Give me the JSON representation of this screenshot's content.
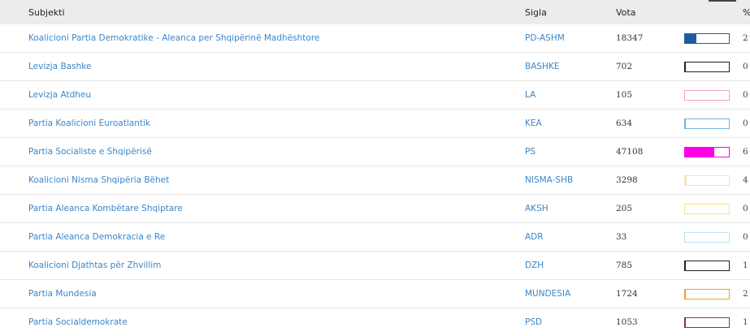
{
  "columns": {
    "subjekti": "Subjekti",
    "sigla": "Sigla",
    "vota": "Vota",
    "percent": "%"
  },
  "rows": [
    {
      "subjekti": "Koalicioni Partia Demokratike - Aleanca per Shqipërinë Madhështore",
      "sigla": "PD-ASHM",
      "vota": "18347",
      "percent_cut": "2",
      "color": "#1f5c9e",
      "fill": 0.26
    },
    {
      "subjekti": "Levizja Bashke",
      "sigla": "BASHKE",
      "vota": "702",
      "percent_cut": "0",
      "color": "#222222",
      "fill": 0.01
    },
    {
      "subjekti": "Levizja Atdheu",
      "sigla": "LA",
      "vota": "105",
      "percent_cut": "0",
      "color": "#f2a6b6",
      "fill": 0.0
    },
    {
      "subjekti": "Partia Koalicioni Euroatlantik",
      "sigla": "KEA",
      "vota": "634",
      "percent_cut": "0",
      "color": "#6fb3e0",
      "fill": 0.01
    },
    {
      "subjekti": "Partia Socialiste e Shqipërisë",
      "sigla": "PS",
      "vota": "47108",
      "percent_cut": "6",
      "color": "#ff00e6",
      "fill": 0.66
    },
    {
      "subjekti": "Koalicioni Nisma Shqipëria Bëhet",
      "sigla": "NISMA-SHB",
      "vota": "3298",
      "percent_cut": "4",
      "color": "#f3e3b8",
      "fill": 0.04
    },
    {
      "subjekti": "Partia Aleanca Kombëtare Shqiptare",
      "sigla": "AKSH",
      "vota": "205",
      "percent_cut": "0",
      "color": "#f7e08a",
      "fill": 0.0
    },
    {
      "subjekti": "Partia Aleanca Demokracia e Re",
      "sigla": "ADR",
      "vota": "33",
      "percent_cut": "0",
      "color": "#bfe4f2",
      "fill": 0.0
    },
    {
      "subjekti": "Koalicioni Djathtas për Zhvillim",
      "sigla": "DZH",
      "vota": "785",
      "percent_cut": "1",
      "color": "#222222",
      "fill": 0.01
    },
    {
      "subjekti": "Partia Mundesia",
      "sigla": "MUNDESIA",
      "vota": "1724",
      "percent_cut": "2",
      "color": "#f0a032",
      "fill": 0.02
    },
    {
      "subjekti": "Partia Socialdemokrate",
      "sigla": "PSD",
      "vota": "1053",
      "percent_cut": "1",
      "color": "#8b2c5c",
      "fill": 0.01
    }
  ]
}
